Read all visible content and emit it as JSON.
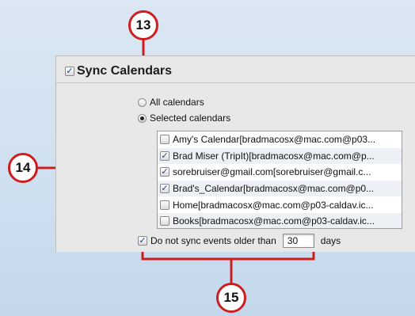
{
  "callouts": {
    "top": "13",
    "left": "14",
    "bottom": "15"
  },
  "sync_section": {
    "title": "Sync Calendars",
    "checked": true
  },
  "options": {
    "all_calendars": "All calendars",
    "selected_calendars": "Selected calendars",
    "selected_value": "Selected calendars"
  },
  "calendars": [
    {
      "label": "Amy's Calendar[bradmacosx@mac.com@p03...",
      "checked": false
    },
    {
      "label": "Brad Miser (TripIt)[bradmacosx@mac.com@p...",
      "checked": true
    },
    {
      "label": "sorebruiser@gmail.com[sorebruiser@gmail.c...",
      "checked": true
    },
    {
      "label": "Brad's_Calendar[bradmacosx@mac.com@p0...",
      "checked": true
    },
    {
      "label": "Home[bradmacosx@mac.com@p03-caldav.ic...",
      "checked": false
    },
    {
      "label": "Books[bradmacosx@mac.com@p03-caldav.ic...",
      "checked": false
    }
  ],
  "older_events": {
    "label_before": "Do not sync events older than",
    "value": "30",
    "label_after": "days",
    "checked": true
  },
  "colors": {
    "callout_ring": "#cf1d1d",
    "connector": "#cf1d1d",
    "checkmark": "#1f3f8f",
    "background": "#cfe0f0"
  },
  "icons": {
    "checkbox_checked": "checkmark-icon",
    "radio_selected": "radio-dot-icon"
  }
}
